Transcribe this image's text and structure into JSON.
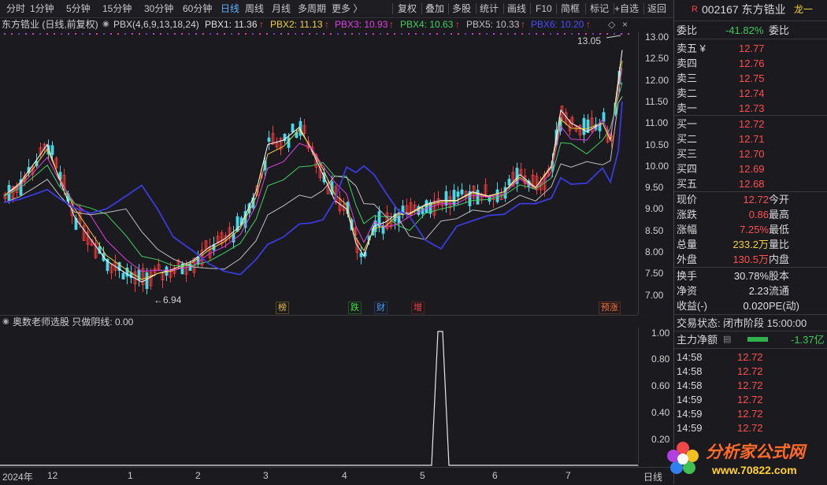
{
  "toolbar": {
    "periods": [
      "分时",
      "1分钟",
      "5分钟",
      "15分钟",
      "30分钟",
      "60分钟",
      "日线",
      "周线",
      "月线",
      "多周期",
      "更多 〉"
    ],
    "active": "日线",
    "actions": [
      "复权",
      "叠加",
      "多股",
      "统计",
      "画线",
      "F10",
      "简框",
      "标记",
      "+自选",
      "返回"
    ]
  },
  "infobar": {
    "stock_label": "东方锆业 (日线,前复权)",
    "indicator": "PBX(4,6,9,13,18,24)",
    "pbx": [
      {
        "label": "PBX1: 11.36",
        "color": "#e0e0e0"
      },
      {
        "label": "PBX2: 11.13",
        "color": "#f0d040"
      },
      {
        "label": "PBX3: 10.93",
        "color": "#e040e0"
      },
      {
        "label": "PBX4: 10.63",
        "color": "#40d060"
      },
      {
        "label": "PBX5: 10.33",
        "color": "#c0c0c0"
      },
      {
        "label": "PBX6: 10.20",
        "color": "#4040e0"
      }
    ],
    "arrow": "↑"
  },
  "main_chart": {
    "y_ticks": [
      "13.00",
      "12.50",
      "12.00",
      "11.50",
      "11.00",
      "10.50",
      "10.00",
      "9.50",
      "9.00",
      "8.50",
      "8.00",
      "7.50",
      "7.00"
    ],
    "high_label": "13.05",
    "low_label": "←6.94",
    "tags": [
      {
        "text": "榜",
        "color": "#e8c040"
      },
      {
        "text": "跌",
        "color": "#40e040"
      },
      {
        "text": "财",
        "color": "#40a0ff"
      },
      {
        "text": "增",
        "color": "#ff4040"
      },
      {
        "text": "预涨",
        "color": "#ff7030"
      }
    ]
  },
  "sub_chart": {
    "title": "奥数老师选股  只做阴线: 0.00",
    "y_ticks": [
      "1.00",
      "0.80",
      "0.60",
      "0.40",
      "0.20"
    ]
  },
  "x_axis": {
    "labels": [
      "2024年",
      "12",
      "1",
      "2",
      "3",
      "4",
      "5",
      "6",
      "7"
    ],
    "right_label": "日线"
  },
  "quote": {
    "code_name": "002167 东方锆业",
    "badge": "R",
    "tag": "龙一",
    "weibi_label": "委比",
    "weibi_value": "-41.82%",
    "weicha_label": "委差",
    "asks": [
      {
        "label": "卖五 ¥",
        "price": "12.77"
      },
      {
        "label": "卖四",
        "price": "12.76"
      },
      {
        "label": "卖三",
        "price": "12.75"
      },
      {
        "label": "卖二",
        "price": "12.74"
      },
      {
        "label": "卖一",
        "price": "12.73"
      }
    ],
    "bids": [
      {
        "label": "买一",
        "price": "12.72"
      },
      {
        "label": "买二",
        "price": "12.71"
      },
      {
        "label": "买三",
        "price": "12.70"
      },
      {
        "label": "买四",
        "price": "12.69"
      },
      {
        "label": "买五",
        "price": "12.68"
      }
    ],
    "stats": [
      {
        "label": "现价",
        "value": "12.72",
        "color": "red",
        "label2": "今开"
      },
      {
        "label": "涨跌",
        "value": "0.86",
        "color": "red",
        "label2": "最高"
      },
      {
        "label": "涨幅",
        "value": "7.25%",
        "color": "red",
        "label2": "最低"
      },
      {
        "label": "总量",
        "value": "233.2万",
        "color": "yellow",
        "label2": "量比"
      },
      {
        "label": "外盘",
        "value": "130.5万",
        "color": "red",
        "label2": "内盘"
      }
    ],
    "stats2": [
      {
        "label": "换手",
        "value": "30.78%",
        "label2": "股本"
      },
      {
        "label": "净资",
        "value": "2.23",
        "label2": "流通"
      },
      {
        "label": "收益(-)",
        "value": "0.020",
        "label2": "PE(动)"
      }
    ],
    "trade_state_label": "交易状态:",
    "trade_state": "闭市阶段 15:00:00",
    "main_flow_label": "主力净额",
    "main_flow_value": "-1.37亿",
    "ticks": [
      {
        "time": "14:58",
        "price": "12.72"
      },
      {
        "time": "14:58",
        "price": "12.72"
      },
      {
        "time": "14:58",
        "price": "12.72"
      },
      {
        "time": "14:59",
        "price": "12.72"
      },
      {
        "time": "14:59",
        "price": "12.72"
      },
      {
        "time": "14:59",
        "price": "12.72"
      }
    ],
    "watermark_title": "分析家公式网",
    "watermark_url": "www.70822.com"
  }
}
